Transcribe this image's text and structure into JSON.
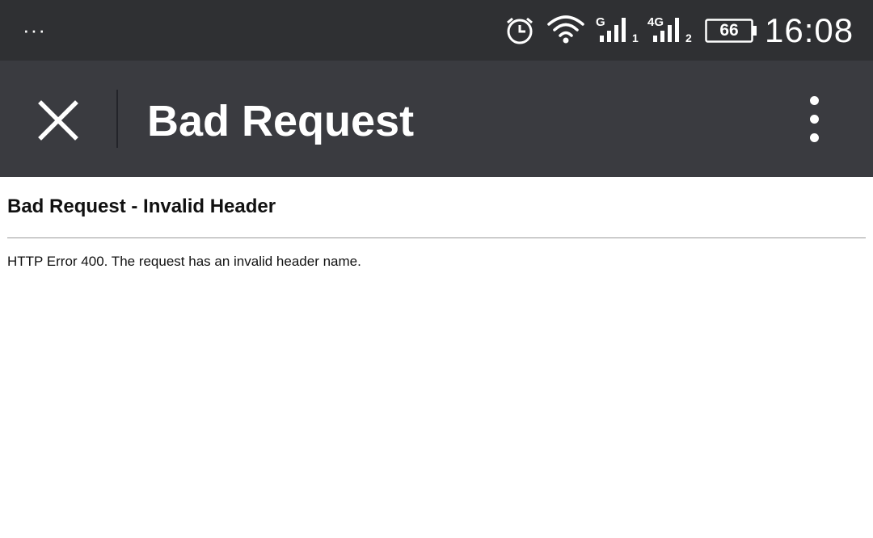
{
  "status_bar": {
    "more_label": "···",
    "sim1_type": "G",
    "sim1_index": "1",
    "sim2_type": "4G",
    "sim2_index": "2",
    "battery_level": "66",
    "time": "16:08"
  },
  "toolbar": {
    "title": "Bad Request"
  },
  "page": {
    "heading": "Bad Request - Invalid Header",
    "message": "HTTP Error 400. The request has an invalid header name."
  },
  "colors": {
    "status_bar_bg": "#2f3033",
    "toolbar_bg": "#3a3b40",
    "page_bg": "#ffffff"
  }
}
